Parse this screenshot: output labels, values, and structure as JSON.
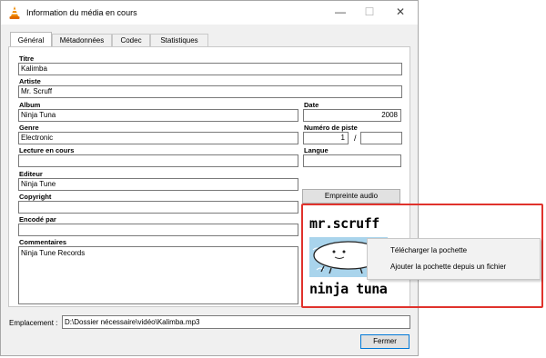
{
  "window": {
    "title": "Information du média en cours",
    "controls": {
      "minimize": "—",
      "maximize": "☐",
      "close": "✕"
    }
  },
  "tabs": [
    {
      "label": "Général",
      "active": true
    },
    {
      "label": "Métadonnées",
      "active": false
    },
    {
      "label": "Codec",
      "active": false
    },
    {
      "label": "Statistiques",
      "active": false
    }
  ],
  "fields": {
    "titre": {
      "label": "Titre",
      "value": "Kalimba"
    },
    "artiste": {
      "label": "Artiste",
      "value": "Mr. Scruff"
    },
    "album": {
      "label": "Album",
      "value": "Ninja Tuna"
    },
    "date": {
      "label": "Date",
      "value": "2008"
    },
    "genre": {
      "label": "Genre",
      "value": "Electronic"
    },
    "piste": {
      "label": "Numéro de piste",
      "value": "1",
      "separator": "/",
      "total": ""
    },
    "lecture": {
      "label": "Lecture en cours",
      "value": ""
    },
    "langue": {
      "label": "Langue",
      "value": ""
    },
    "editeur": {
      "label": "Editeur",
      "value": "Ninja Tune"
    },
    "copyright": {
      "label": "Copyright",
      "value": ""
    },
    "encode": {
      "label": "Encodé par",
      "value": ""
    },
    "commentaires": {
      "label": "Commentaires",
      "value": "Ninja Tune Records"
    }
  },
  "fingerprint_button": "Empreinte audio",
  "cover": {
    "line1": "mr.scruff",
    "line2": "ninja tuna"
  },
  "context_menu": [
    "Télécharger la pochette",
    "Ajouter la pochette depuis un fichier"
  ],
  "location": {
    "label": "Emplacement :",
    "value": "D:\\Dossier nécessaire\\vidéo\\Kalimba.mp3"
  },
  "close_button": "Fermer",
  "colors": {
    "highlight": "#e0322c",
    "vlc_orange": "#f08a00",
    "button_focus": "#0078d7"
  },
  "icons": [
    "vlc-cone-icon",
    "minimize-icon",
    "maximize-icon",
    "close-icon"
  ]
}
